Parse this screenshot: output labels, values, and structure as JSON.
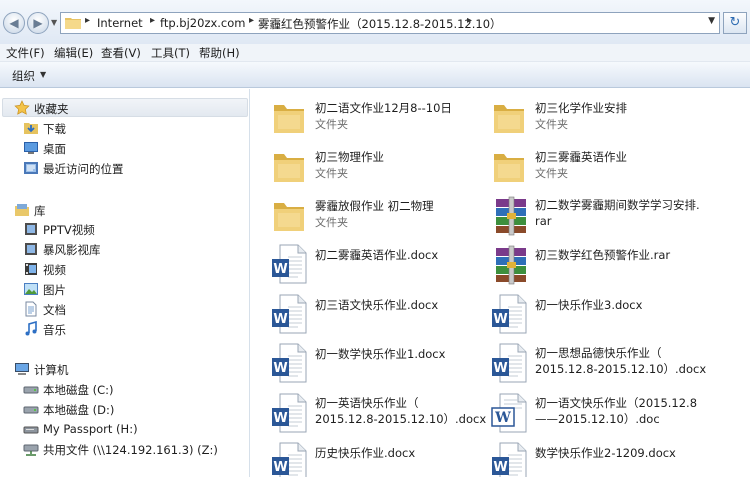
{
  "address": {
    "crumbs": [
      "Internet",
      "ftp.bj20zx.com",
      "雾霾红色预警作业（2015.12.8-2015.12.10）"
    ]
  },
  "menu": {
    "file": "文件(F)",
    "edit": "编辑(E)",
    "view": "查看(V)",
    "tools": "工具(T)",
    "help": "帮助(H)"
  },
  "toolbar": {
    "organize": "组织"
  },
  "nav": {
    "favorites": "收藏夹",
    "fav_items": [
      "下载",
      "桌面",
      "最近访问的位置"
    ],
    "libraries": "库",
    "lib_items": [
      "PPTV视频",
      "暴风影视库",
      "视频",
      "图片",
      "文档",
      "音乐"
    ],
    "computer": "计算机",
    "comp_items": [
      "本地磁盘 (C:)",
      "本地磁盘 (D:)",
      "My Passport (H:)",
      "共用文件 (\\\\124.192.161.3) (Z:)"
    ]
  },
  "files": [
    {
      "icon": "folder-icon",
      "name": "初二语文作业12月8--10日",
      "type": "文件夹"
    },
    {
      "icon": "folder-icon",
      "name": "初三化学作业安排",
      "type": "文件夹"
    },
    {
      "icon": "folder-icon",
      "name": "初三物理作业",
      "type": "文件夹"
    },
    {
      "icon": "folder-icon",
      "name": "初三雾霾英语作业",
      "type": "文件夹"
    },
    {
      "icon": "folder-icon",
      "name": "雾霾放假作业 初二物理",
      "type": "文件夹"
    },
    {
      "icon": "rar-icon",
      "name": "初二数学雾霾期间数学学习安排.",
      "name2": "rar"
    },
    {
      "icon": "word-icon",
      "name": "初二雾霾英语作业.docx"
    },
    {
      "icon": "rar-icon",
      "name": "初三数学红色预警作业.rar"
    },
    {
      "icon": "word-icon",
      "name": "初三语文快乐作业.docx"
    },
    {
      "icon": "word-icon",
      "name": "初一快乐作业3.docx"
    },
    {
      "icon": "word-icon",
      "name": "初一数学快乐作业1.docx"
    },
    {
      "icon": "word-icon",
      "name": "初一思想品德快乐作业（",
      "name2": "2015.12.8-2015.12.10）.docx"
    },
    {
      "icon": "word-icon",
      "name": "初一英语快乐作业（",
      "name2": "2015.12.8-2015.12.10）.docx"
    },
    {
      "icon": "word-old-icon",
      "name": "初一语文快乐作业（2015.12.8",
      "name2": "——2015.12.10）.doc"
    },
    {
      "icon": "word-icon",
      "name": "历史快乐作业.docx"
    },
    {
      "icon": "word-icon",
      "name": "数学快乐作业2-1209.docx"
    }
  ]
}
